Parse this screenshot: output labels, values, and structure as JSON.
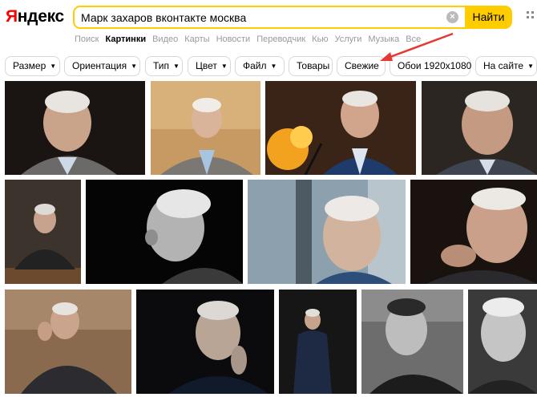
{
  "logo": {
    "first_letter": "Я",
    "rest": "ндекс"
  },
  "search": {
    "query": "Марк захаров вконтакте москва",
    "clear_icon": "close-icon",
    "button_label": "Найти"
  },
  "services": [
    "Поиск",
    "Картинки",
    "Видео",
    "Карты",
    "Новости",
    "Переводчик",
    "Кью",
    "Услуги",
    "Музыка",
    "Все"
  ],
  "filters": {
    "size": "Размер",
    "orientation": "Ориентация",
    "type": "Тип",
    "color": "Цвет",
    "file": "Файл",
    "goods": "Товары",
    "fresh": "Свежие",
    "wallpaper": "Обои 1920x1080",
    "on_site": "На сайте"
  },
  "annotation": {
    "arrow_color": "#e53935",
    "points_to": "fresh-filter"
  },
  "images": [
    {
      "alt": "portrait-1",
      "bg": "#1a1412"
    },
    {
      "alt": "portrait-2",
      "bg": "#c79a63"
    },
    {
      "alt": "portrait-3",
      "bg": "#3a2418"
    },
    {
      "alt": "portrait-4",
      "bg": "#2b2622"
    },
    {
      "alt": "portrait-5",
      "bg": "#3c342c"
    },
    {
      "alt": "portrait-6",
      "bg": "#050505"
    },
    {
      "alt": "portrait-7",
      "bg": "#8da0ad"
    },
    {
      "alt": "portrait-8",
      "bg": "#1a120e"
    },
    {
      "alt": "portrait-9",
      "bg": "#8a6a4f"
    },
    {
      "alt": "portrait-10",
      "bg": "#0b0b0d"
    },
    {
      "alt": "portrait-11",
      "bg": "#161616"
    },
    {
      "alt": "portrait-12",
      "bg": "#6d6d6d"
    },
    {
      "alt": "portrait-13",
      "bg": "#3a3a3a"
    }
  ]
}
